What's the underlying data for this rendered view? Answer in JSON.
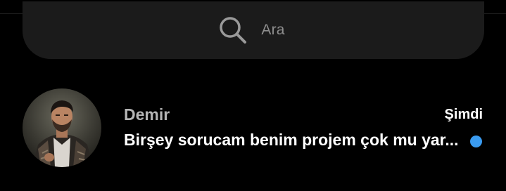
{
  "search": {
    "placeholder": "Ara",
    "icon": "search-icon"
  },
  "chats": [
    {
      "name": "Demir",
      "time": "Şimdi",
      "preview": "Birşey sorucam benim projem çok mu yar...",
      "unread": true,
      "avatar_icon": "avatar-photo"
    }
  ],
  "colors": {
    "background": "#000000",
    "search_bg": "#1b1b1b",
    "unread_dot": "#3a9bf0",
    "name_text": "#b5b5b5",
    "primary_text": "#ffffff"
  }
}
